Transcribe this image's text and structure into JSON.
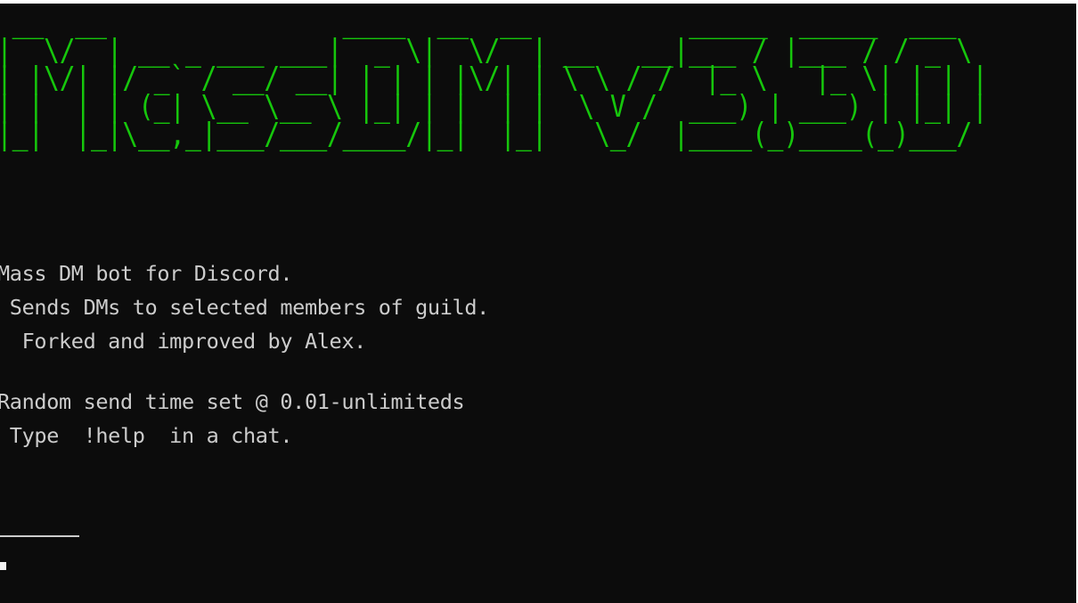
{
  "banner": {
    "ascii_art": " __  __               ____  __  __          _____  _____  ___  \n|  \\/  | __ _ ___ ___|  _ \\|  \\/  | __   __|___ / |___ / / _ \\ \n| |\\/| |/ _` / __/ __| | | | |\\/| | \\ \\ / /  |_ \\   |_ \\| | | |\n| |  | | (_| \\__ \\__ \\ |_| | |  | |  \\ V /  ___) | ___) | |_| |\n|_|  |_|\\__,_|___/___/____/|_|  |_|   \\_/  |____(_)____(_)___/ ",
    "title_text": "MassDM v3.3.0",
    "color": "#16c60c"
  },
  "output": {
    "line1": "Mass DM bot for Discord.",
    "line2": " Sends DMs to selected members of guild.",
    "line3": "  Forked and improved by Alex.",
    "line4": "Random send time set @ 0.01-unlimiteds",
    "line5": " Type  !help  in a chat.",
    "text_color": "#cccccc"
  },
  "console_background": "#0c0c0c"
}
